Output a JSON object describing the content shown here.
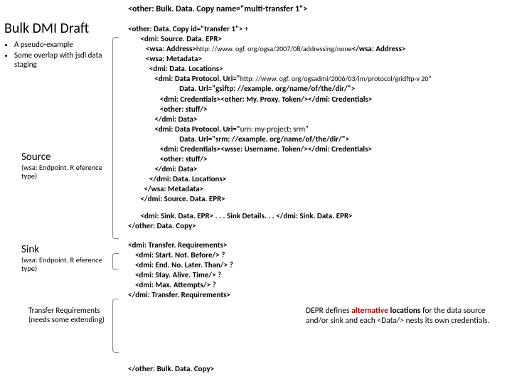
{
  "topTitle": "<other: Bulk. Data. Copy   name=\"multi-transfer 1\">",
  "slideTitle": "Bulk DMI Draft",
  "bullets": [
    "A pseudo-example",
    "Some overlap with jsdl data staging"
  ],
  "source": {
    "title": "Source",
    "sub": "(wsa: Endpoint. R eference type)"
  },
  "sink": {
    "title": "Sink",
    "sub": "(wsa: Endpoint. R eference type)"
  },
  "treq": "Transfer Requirements (needs some extending)",
  "code": {
    "l1a": "<other: Data. Copy id=\"transfer 1\"> ",
    "l1b": "+",
    "l2": "       <dmi: Source. Data. EPR>",
    "l3a": "          <wsa: Address>",
    "l3b": "http: //www. ogf. org/ogsa/2007/08/addressing/none",
    "l3c": "</wsa: Address>",
    "l4": "          <wsa: Metadata>",
    "l5": "            <dmi: Data. Locations>",
    "l6a": "               <dmi: Data Protocol. Uri=\"",
    "l6b": "http: //www. ogf. org/ogsadmi/2006/03/im/protocol/gridftp-v 20\"",
    "l7": "                             Data. Url=\"gsiftp: //example. org/name/of/the/dir/\">",
    "l8": "                  <dmi: Credentials><other: My. Proxy. Token/></dmi: Credentials>",
    "l9": "                  <other: stuff/>",
    "l10": "               </dmi: Data>",
    "l11a": "               <dmi: Data Protocol. Uri=\"",
    "l11b": "urn: my-project: srm\"",
    "l12": "                             Data. Url=\"srm: //example. org/name/of/the/dir/\">",
    "l13": "                  <dmi: Credentials><wsse: Username. Token/></dmi: Credentials>",
    "l14": "                  <other: stuff/>",
    "l15": "               </dmi: Data>",
    "l16": "            </dmi: Data. Locations>",
    "l17": "         </wsa: Metadata>",
    "l18": "       </dmi: Source. Data. EPR>",
    "sinkline": "       <dmi: Sink. Data. EPR> . . . Sink Details. . . </dmi: Sink. Data. EPR>",
    "closecopy": "</other: Data. Copy>",
    "tr1": "<dmi: Transfer. Requirements>",
    "tr2": "    <dmi: Start. Not. Before/> ?",
    "tr3": "    <dmi: End. No. Later. Than/> ?",
    "tr4": "    <dmi: Stay. Alive. Time/> ?",
    "tr5": "    <dmi: Max. Attempts/> ?",
    "tr6": "</dmi: Transfer. Requirements>",
    "final": "</other: Bulk. Data. Copy>"
  },
  "comment": {
    "p1": "DEPR defines ",
    "alt": "alternative",
    "p2": " locations",
    "p3": " for the data source and/or sink and each <Data/> nests its own credentials."
  }
}
